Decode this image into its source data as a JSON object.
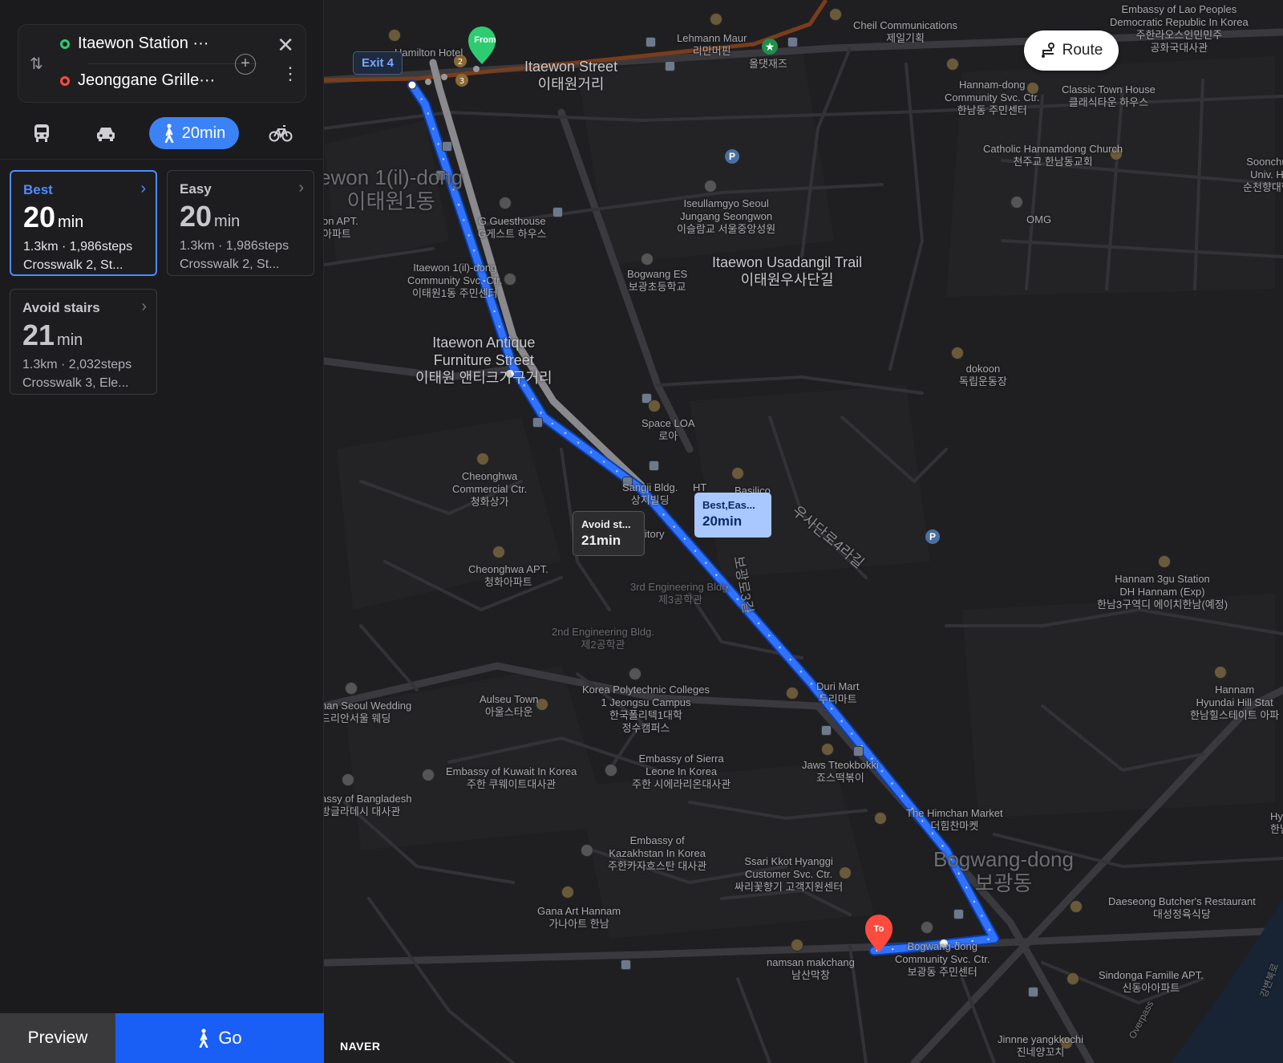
{
  "origin": "Itaewon Station ···",
  "destination": "Jeonggane Grille···",
  "modes": {
    "walk_time": "20min"
  },
  "options": [
    {
      "title": "Best",
      "minutes": "20",
      "unit": "min",
      "line1": "1.3km · 1,986steps",
      "line2": "Crosswalk 2, St..."
    },
    {
      "title": "Easy",
      "minutes": "20",
      "unit": "min",
      "line1": "1.3km · 1,986steps",
      "line2": "Crosswalk 2, St..."
    },
    {
      "title": "Avoid stairs",
      "minutes": "21",
      "unit": "min",
      "line1": "1.3km · 2,032steps",
      "line2": "Crosswalk 3, Ele..."
    }
  ],
  "buttons": {
    "preview": "Preview",
    "go": "Go",
    "route": "Route"
  },
  "map": {
    "exit_label": "Exit 4",
    "from_pin": "From",
    "to_pin": "To",
    "tooltip_best": {
      "title": "Best,Eas...",
      "time": "20min"
    },
    "tooltip_avoid": {
      "title": "Avoid st...",
      "time": "21min"
    },
    "brand": "NAVER",
    "labels": {
      "itaewon_street": "Itaewon Street",
      "itaewon_street_kr": "이태원거리",
      "itaewon1dong": "ewon 1(il)-dong",
      "itaewon1dong_kr": "이태원1동",
      "usadangil": "Itaewon Usadangil Trail",
      "usadangil_kr": "이태원우사단길",
      "antique": "Itaewon Antique",
      "antique2": "Furniture Street",
      "antique_kr": "이태원 앤티크가구거리",
      "bogwang": "Bogwang-dong",
      "bogwang_kr": "보광동",
      "embassy_lao": "Embassy of Lao Peoples",
      "embassy_lao2": "Democratic Republic In Korea",
      "embassy_lao_kr": "주한라오스인민민주",
      "embassy_lao_kr2": "공화국대사관",
      "cheil": "Cheil Communications",
      "cheil_kr": "제일기획",
      "lehmann": "Lehmann Maur",
      "lehmann_kr": "리만머핀",
      "alltheat_kr": "올댓재즈",
      "hotel": "Hamilton Hotel",
      "hannam_center": "Hannam-dong",
      "hannam_center2": "Community Svc. Ctr.",
      "hannam_center_kr": "한남동 주민센터",
      "classic": "Classic Town House",
      "classic_kr": "클래식타운 하우스",
      "catholic": "Catholic Hannamdong Church",
      "catholic_kr": "천주교 한남동교회",
      "soonchun": "Soonchu",
      "soonchun2": "Univ. H",
      "soonchun_kr": "순천향대학",
      "omg": "OMG",
      "iseullamgyo": "Iseullamgyo Seoul",
      "iseullamgyo2": "Jungang Seongwon",
      "iseullamgyo_kr": "이슬람교 서울중앙성원",
      "guesthouse": "G Guesthouse",
      "guesthouse_kr": "G게스트 하우스",
      "apt_left": "on APT.",
      "apt_left_kr": "아파트",
      "itaewon1_ctr": "Itaewon 1(il)-dong",
      "itaewon1_ctr2": "Community Svc. Ctr.",
      "itaewon1_ctr_kr": "이태원1동 주민센터",
      "bogwang_es": "Bogwang ES",
      "bogwang_es_kr": "보광초등학교",
      "dokoon": "dokoon",
      "dokoon_kr": "독립운동장",
      "space_loa": "Space LOA",
      "space_loa_kr": "로아",
      "sangji": "Sangji Bldg.",
      "sangji_kr": "상지빌딩",
      "cheonghwa_comm": "Cheonghwa",
      "cheonghwa_comm2": "Commercial Ctr.",
      "cheonghwa_comm_kr": "청화상가",
      "cheonghwa_apt": "Cheonghwa APT.",
      "cheonghwa_apt_kr": "청화아파트",
      "ust_road": "우사단로4라길",
      "bogwang_road": "보광로3길",
      "eng3": "3rd Engineering Bldg.",
      "eng3_kr": "제3공학관",
      "eng2": "2nd Engineering Bldg.",
      "eng2_kr": "제2공학관",
      "hannam3gu": "Hannam 3gu Station",
      "hannam3gu2": "DH Hannam (Exp)",
      "hannam3gu_kr": "한남3구역디 에이치한남(예정)",
      "duri": "Duri Mart",
      "duri_kr": "두리마트",
      "polytech": "Korea Polytechnic Colleges",
      "polytech2": "1 Jeongsu Campus",
      "polytech_kr": "한국폴리텍1대학",
      "polytech_kr2": "정수캠퍼스",
      "aulseu": "Aulseu Town",
      "aulseu_kr": "아울스타운",
      "wedding": "nan Seoul Wedding",
      "wedding_kr": "드리안서울 웨딩",
      "hannam_hyundai": "Hannam",
      "hannam_hyundai2": "Hyundai Hill Stat",
      "hannam_hyundai_kr": "한남힐스테이트 아파",
      "jaws": "Jaws Tteokbokki",
      "jaws_kr": "죠스떡볶이",
      "sierra": "Embassy of Sierra",
      "sierra2": "Leone In Korea",
      "sierra_kr": "주한 시에라리온대사관",
      "kuwait": "Embassy of Kuwait In Korea",
      "kuwait_kr": "주한 쿠웨이트대사관",
      "bangladesh": "assy of Bangladesh",
      "bangladesh_kr": "방글라데시 대사관",
      "himchan": "The Himchan Market",
      "himchan_kr": "더힘찬마켓",
      "hy": "Hy",
      "hy2": "한남",
      "kazakh": "Embassy of",
      "kazakh2": "Kazakhstan In Korea",
      "kazakh_kr": "주한카자흐스탄 대사관",
      "ssari": "Ssari Kkot Hyanggi",
      "ssari2": "Customer Svc. Ctr.",
      "ssari_kr": "싸리꽃향기 고객지원센터",
      "daeseong": "Daeseong Butcher's Restaurant",
      "daeseong_kr": "대성정육식당",
      "gana": "Gana Art Hannam",
      "gana_kr": "가나아트 한남",
      "namsan": "namsan makchang",
      "namsan_kr": "남산막창",
      "bogwang_ctr": "Bogwang-dong",
      "bogwang_ctr2": "Community Svc. Ctr.",
      "bogwang_ctr_kr": "보광동 주민센터",
      "sindonga": "Sindonga Famille APT.",
      "sindonga_kr": "신동아아파트",
      "jinnne": "Jinnne yangkkochi",
      "jinnne_kr": "진네양꼬치",
      "ht": "HT",
      "basilico": "Basilico",
      "itory": "itory",
      "overpass": "Overpass",
      "gangbyeon": "강변북로"
    }
  }
}
